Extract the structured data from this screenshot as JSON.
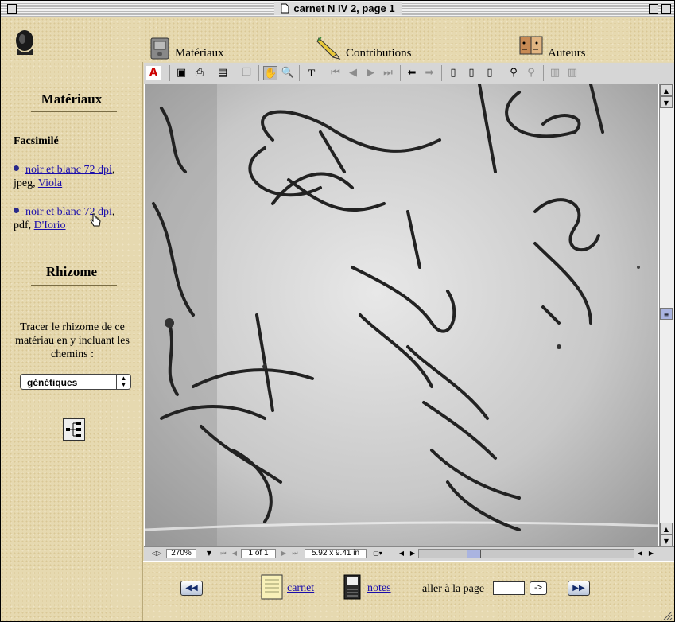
{
  "window": {
    "title": "carnet N IV 2, page 1"
  },
  "topnav": {
    "items": [
      {
        "label": "Matériaux",
        "icon": "materials-icon"
      },
      {
        "label": "Contributions",
        "icon": "pencil-icon"
      },
      {
        "label": "Auteurs",
        "icon": "authors-icon"
      }
    ]
  },
  "sidebar": {
    "section1_title": "Matériaux",
    "facsimile_heading": "Facsimilé",
    "items": [
      {
        "link": "noir et blanc 72 dpi",
        "format": "jpeg",
        "author": "Viola"
      },
      {
        "link": "noir et blanc 72 dpi",
        "format": "pdf",
        "author": "D'Iorio"
      }
    ],
    "section2_title": "Rhizome",
    "rhizome_text": "Tracer le rhizome de ce matériau en y incluant les chemins :",
    "select_value": "génétiques",
    "comma": ","
  },
  "viewer": {
    "zoom": "270%",
    "page_indicator": "1 of 1",
    "page_size": "5.92 x 9.41 in"
  },
  "bottom": {
    "carnet_label": "carnet",
    "notes_label": "notes",
    "goto_label": "aller à la page",
    "go_button": "->",
    "page_value": ""
  },
  "colors": {
    "paper": "#e3d8b4",
    "link": "#1a0dab",
    "nav_button": "#b8c4d8"
  }
}
